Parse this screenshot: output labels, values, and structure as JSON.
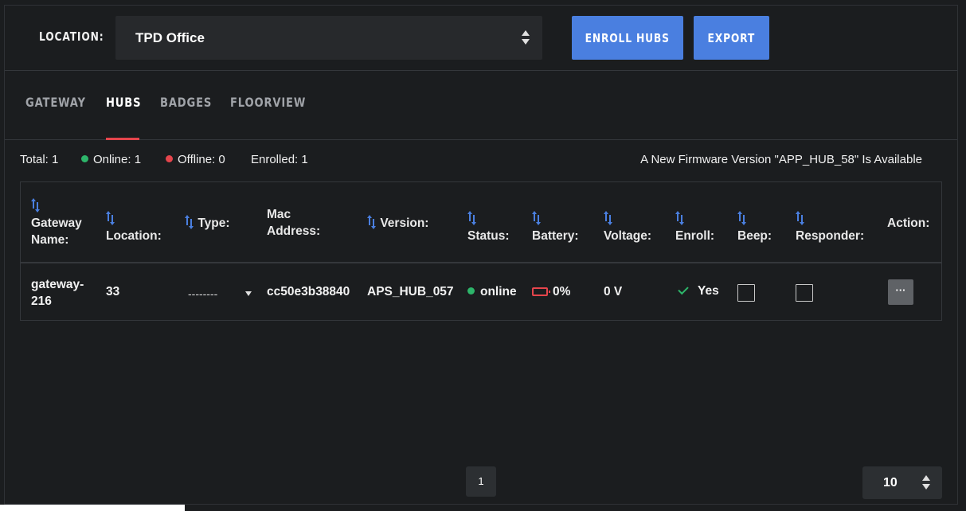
{
  "header": {
    "location_label": "LOCATION:",
    "location_value": "TPD Office",
    "enroll_button": "ENROLL HUBS",
    "export_button": "EXPORT"
  },
  "tabs": [
    {
      "label": "GATEWAY",
      "active": false
    },
    {
      "label": "HUBS",
      "active": true
    },
    {
      "label": "BADGES",
      "active": false
    },
    {
      "label": "FLOORVIEW",
      "active": false
    }
  ],
  "summary": {
    "total": "Total: 1",
    "online": "Online: 1",
    "offline": "Offline: 0",
    "enrolled": "Enrolled: 1",
    "firmware_notice": "A New Firmware Version \"APP_HUB_58\" Is Available"
  },
  "colors": {
    "accent": "#4a7fe0",
    "online": "#2db56a",
    "offline": "#e5454c"
  },
  "table": {
    "columns": {
      "gateway_name_1": "Gateway",
      "gateway_name_2": "Name:",
      "location": "Location:",
      "type": "Type:",
      "mac_1": "Mac",
      "mac_2": "Address:",
      "version": "Version:",
      "status": "Status:",
      "battery": "Battery:",
      "voltage": "Voltage:",
      "enroll": "Enroll:",
      "beep": "Beep:",
      "responder": "Responder:",
      "action": "Action:"
    },
    "rows": [
      {
        "gateway_name_1": "gateway-",
        "gateway_name_2": "216",
        "location": "33",
        "type": "--------",
        "mac": "cc50e3b38840",
        "version": "APS_HUB_057",
        "status": "online",
        "battery": "0%",
        "voltage": "0 V",
        "enroll": "Yes",
        "action": "···"
      }
    ]
  },
  "pagination": {
    "current_page": "1",
    "per_page": "10"
  }
}
